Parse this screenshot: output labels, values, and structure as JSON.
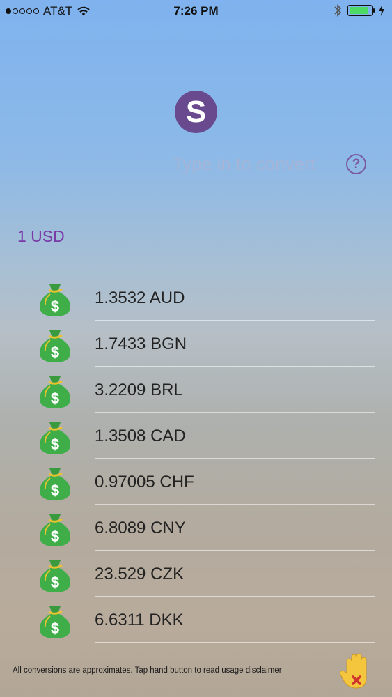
{
  "status_bar": {
    "carrier": "AT&T",
    "time": "7:26 PM",
    "signal_filled": 1,
    "signal_total": 5,
    "battery_fraction": 0.85,
    "battery_color": "#4cd964"
  },
  "logo": {
    "letter": "S",
    "color": "#6a4a8e"
  },
  "converter": {
    "placeholder": "Type in to convert",
    "value": "",
    "help_label": "?"
  },
  "base_amount": "1 USD",
  "rates": [
    {
      "text": "1.3532 AUD"
    },
    {
      "text": "1.7433 BGN"
    },
    {
      "text": "3.2209 BRL"
    },
    {
      "text": "1.3508 CAD"
    },
    {
      "text": "0.97005 CHF"
    },
    {
      "text": "6.8089 CNY"
    },
    {
      "text": "23.529 CZK"
    },
    {
      "text": "6.6311 DKK"
    }
  ],
  "icons": {
    "rate_icon": "money-bag-icon",
    "hand": "hand-icon"
  },
  "footer": {
    "disclaimer": "All conversions are approximates. Tap hand button to read usage disclaimer"
  }
}
